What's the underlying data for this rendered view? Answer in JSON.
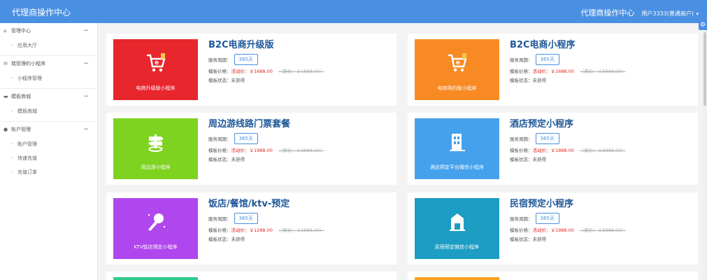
{
  "header": {
    "brand": "代理商操作中心",
    "center_title": "代理商操作中心",
    "user": "用户3333(普通商户)"
  },
  "sidebar": {
    "groups": [
      {
        "title": "管理中心",
        "icon": "home-icon",
        "items": [
          "应用大厅"
        ]
      },
      {
        "title": "我管理的小程序",
        "icon": "chat-icon",
        "items": [
          "小程序管理"
        ]
      },
      {
        "title": "模板商城",
        "icon": "shop-icon",
        "items": [
          "模板商城"
        ]
      },
      {
        "title": "账户管理",
        "icon": "user-icon",
        "items": [
          "账户管理",
          "快速充值",
          "充值订单"
        ]
      }
    ]
  },
  "labels": {
    "period": "服务周期：",
    "price": "模板价格：",
    "status": "模板状态：未获得"
  },
  "cards": [
    {
      "title": "B2C电商升级版",
      "thumb_label": "电商升级版小程序",
      "color": "#e8262d",
      "icon": "shopping-cart-icon",
      "period": "365天",
      "price": "活动价：￥1688.00",
      "orig": "（原价：￥1888.00）"
    },
    {
      "title": "B2C电商小程序",
      "thumb_label": "电商简约版小程序",
      "color": "#f78a23",
      "icon": "shopping-cart-icon",
      "period": "365天",
      "price": "活动价：￥1688.00",
      "orig": "（原价：￥5888.00）"
    },
    {
      "title": "周边游线路门票套餐",
      "thumb_label": "周边游小程序",
      "color": "#7ed321",
      "icon": "signpost-icon",
      "period": "365天",
      "price": "活动价：￥1988.00",
      "orig": "（原价：￥9888.00）"
    },
    {
      "title": "酒店预定小程序",
      "thumb_label": "酒店预定平台微信小程序",
      "color": "#45a1ec",
      "icon": "building-icon",
      "period": "365天",
      "price": "活动价：￥1888.00",
      "orig": "（原价：￥9888.00）"
    },
    {
      "title": "饭店/餐馆/ktv-预定",
      "thumb_label": "KTV饭店预定小程序",
      "color": "#b046ee",
      "icon": "microphone-icon",
      "period": "365天",
      "price": "活动价：￥1288.00",
      "orig": "（原价：￥1688.00）"
    },
    {
      "title": "民宿预定小程序",
      "thumb_label": "民宿预定微信小程序",
      "color": "#1d9dc4",
      "icon": "house-icon",
      "period": "365天",
      "price": "活动价：￥1988.00",
      "orig": "（原价：￥9888.00）"
    },
    {
      "title": "",
      "thumb_label": "",
      "color": "#2ecb8e",
      "icon": "",
      "period": "",
      "price": "",
      "orig": ""
    },
    {
      "title": "",
      "thumb_label": "",
      "color": "#f7a120",
      "icon": "",
      "period": "",
      "price": "",
      "orig": ""
    }
  ]
}
